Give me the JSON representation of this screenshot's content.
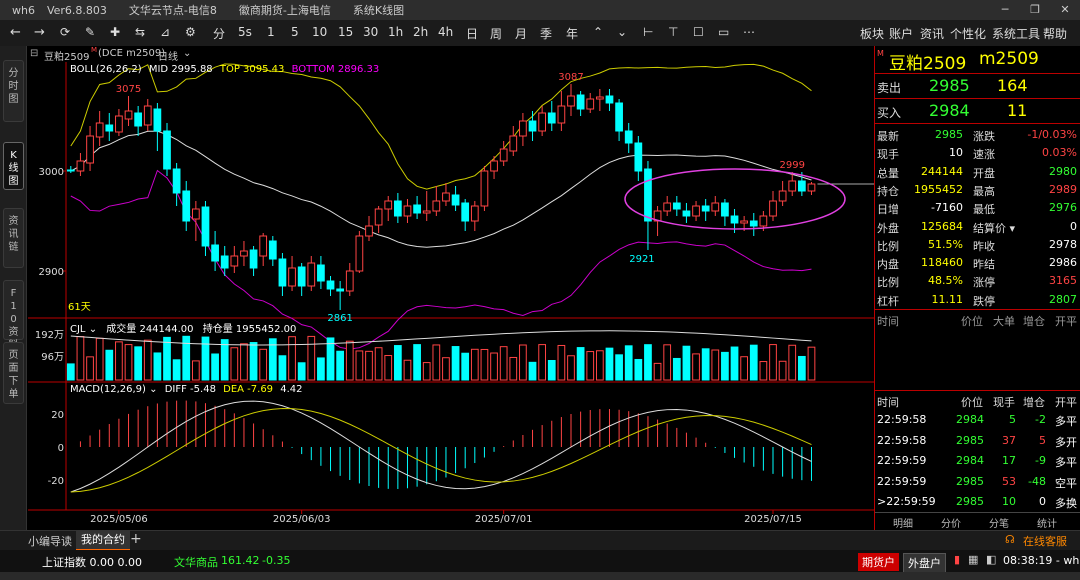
{
  "titlebar": {
    "app": "wh6",
    "version": "Ver6.8.803",
    "server": "文华云节点-电信8",
    "broker": "徽商期货-上海电信",
    "module": "系统K线图"
  },
  "toolbar": {
    "periods": [
      "分",
      "5s",
      "1",
      "5",
      "10",
      "15",
      "30",
      "1h",
      "2h",
      "4h",
      "日",
      "周",
      "月",
      "季",
      "年"
    ],
    "menu": [
      "板块",
      "账户",
      "资讯",
      "个性化",
      "系统工具",
      "帮助"
    ]
  },
  "sidebar": {
    "tabs": [
      "分时图",
      "K线图",
      "资讯链",
      "F10资料",
      "页面下单"
    ]
  },
  "chart_header": {
    "contract": "豆粕2509",
    "superscript": "M",
    "exchange": "(DCE m2509)",
    "period": "日线"
  },
  "boll": {
    "name": "BOLL(26,26,2)",
    "mid": "MID 2995.88",
    "top": "TOP 3095.43",
    "bottom": "BOTTOM 2896.33"
  },
  "cjl": {
    "name": "CJL",
    "vol": "成交量 244144.00",
    "oi": "持仓量 1955452.00",
    "ticks": [
      "192万",
      "96万"
    ]
  },
  "macd": {
    "name": "MACD(12,26,9)",
    "diff": "DIFF -5.48",
    "dea": "DEA -7.69",
    "macd": "4.42",
    "ticks": [
      "20",
      "0",
      "-20"
    ]
  },
  "price_labels": {
    "ticks": [
      "3000",
      "2900"
    ],
    "high1": "3075",
    "high2": "3087",
    "low1": "2861",
    "low2": "2921",
    "high3": "2999",
    "days": "61天"
  },
  "dates": [
    "2025/05/06",
    "2025/06/03",
    "2025/07/01",
    "2025/07/15"
  ],
  "chart_data": {
    "type": "candlestick",
    "title": "豆粕2509 日线",
    "ylim": [
      2855,
      3105
    ],
    "candles": [
      [
        3001,
        3000,
        2998,
        3005
      ],
      [
        3000,
        3010,
        2995,
        3018
      ],
      [
        3008,
        3035,
        3000,
        3045
      ],
      [
        3034,
        3048,
        3025,
        3060
      ],
      [
        3046,
        3040,
        3030,
        3058
      ],
      [
        3039,
        3055,
        3035,
        3062
      ],
      [
        3052,
        3060,
        3045,
        3075
      ],
      [
        3058,
        3045,
        3035,
        3065
      ],
      [
        3046,
        3065,
        3040,
        3072
      ],
      [
        3062,
        3040,
        3020,
        3068
      ],
      [
        3040,
        3002,
        2995,
        3048
      ],
      [
        3002,
        2978,
        2965,
        3008
      ],
      [
        2980,
        2950,
        2940,
        2990
      ],
      [
        2952,
        2962,
        2930,
        2970
      ],
      [
        2964,
        2925,
        2915,
        2970
      ],
      [
        2926,
        2910,
        2900,
        2940
      ],
      [
        2915,
        2903,
        2895,
        2925
      ],
      [
        2905,
        2915,
        2898,
        2925
      ],
      [
        2915,
        2920,
        2905,
        2930
      ],
      [
        2921,
        2903,
        2895,
        2925
      ],
      [
        2915,
        2935,
        2905,
        2938
      ],
      [
        2930,
        2912,
        2905,
        2935
      ],
      [
        2912,
        2885,
        2875,
        2918
      ],
      [
        2885,
        2903,
        2880,
        2915
      ],
      [
        2904,
        2885,
        2875,
        2908
      ],
      [
        2885,
        2908,
        2880,
        2915
      ],
      [
        2906,
        2890,
        2882,
        2915
      ],
      [
        2890,
        2882,
        2875,
        2895
      ],
      [
        2882,
        2880,
        2861,
        2890
      ],
      [
        2880,
        2900,
        2875,
        2908
      ],
      [
        2900,
        2935,
        2898,
        2940
      ],
      [
        2935,
        2945,
        2930,
        2955
      ],
      [
        2946,
        2962,
        2938,
        2965
      ],
      [
        2962,
        2970,
        2950,
        2975
      ],
      [
        2970,
        2955,
        2948,
        2978
      ],
      [
        2955,
        2965,
        2948,
        2972
      ],
      [
        2966,
        2958,
        2952,
        2975
      ],
      [
        2958,
        2960,
        2950,
        2980
      ],
      [
        2960,
        2970,
        2955,
        2985
      ],
      [
        2970,
        2978,
        2965,
        2988
      ],
      [
        2976,
        2966,
        2960,
        2985
      ],
      [
        2968,
        2950,
        2940,
        2972
      ],
      [
        2950,
        2965,
        2940,
        2970
      ],
      [
        2965,
        3000,
        2960,
        3005
      ],
      [
        3000,
        3010,
        2992,
        3015
      ],
      [
        3010,
        3022,
        3005,
        3030
      ],
      [
        3020,
        3035,
        3015,
        3045
      ],
      [
        3035,
        3050,
        3025,
        3058
      ],
      [
        3050,
        3040,
        3030,
        3060
      ],
      [
        3040,
        3058,
        3035,
        3065
      ],
      [
        3058,
        3048,
        3040,
        3070
      ],
      [
        3048,
        3065,
        3040,
        3080
      ],
      [
        3065,
        3075,
        3055,
        3087
      ],
      [
        3076,
        3062,
        3055,
        3080
      ],
      [
        3062,
        3072,
        3058,
        3078
      ],
      [
        3072,
        3074,
        3060,
        3082
      ],
      [
        3075,
        3068,
        3060,
        3082
      ],
      [
        3068,
        3040,
        3030,
        3072
      ],
      [
        3040,
        3028,
        3018,
        3048
      ],
      [
        3028,
        3000,
        2990,
        3035
      ],
      [
        3002,
        2950,
        2921,
        3010
      ],
      [
        2950,
        2960,
        2935,
        2965
      ],
      [
        2960,
        2968,
        2955,
        2975
      ],
      [
        2968,
        2962,
        2955,
        2975
      ],
      [
        2960,
        2955,
        2948,
        2968
      ],
      [
        2955,
        2965,
        2950,
        2970
      ],
      [
        2965,
        2960,
        2950,
        2972
      ],
      [
        2960,
        2968,
        2955,
        2975
      ],
      [
        2968,
        2955,
        2945,
        2972
      ],
      [
        2955,
        2948,
        2938,
        2962
      ],
      [
        2948,
        2950,
        2940,
        2955
      ],
      [
        2950,
        2945,
        2935,
        2958
      ],
      [
        2945,
        2955,
        2940,
        2960
      ],
      [
        2955,
        2970,
        2950,
        2980
      ],
      [
        2970,
        2980,
        2965,
        2990
      ],
      [
        2980,
        2990,
        2975,
        2999
      ],
      [
        2990,
        2980,
        2975,
        2999
      ],
      [
        2980,
        2987,
        2976,
        2989
      ]
    ]
  },
  "quote": {
    "title": "豆粕2509",
    "code": "m2509",
    "sell_label": "卖出",
    "sell": "2985",
    "sell_vol": "164",
    "buy_label": "买入",
    "buy": "2984",
    "buy_vol": "11",
    "rows": [
      [
        "最新",
        "2985",
        "g",
        "涨跌",
        "-1/0.03%",
        "r"
      ],
      [
        "现手",
        "10",
        "w",
        "速涨",
        "0.03%",
        "r"
      ],
      [
        "总量",
        "244144",
        "y",
        "开盘",
        "2980",
        "g"
      ],
      [
        "持仓",
        "1955452",
        "y",
        "最高",
        "2989",
        "r"
      ],
      [
        "日增",
        "-7160",
        "w",
        "最低",
        "2976",
        "g"
      ],
      [
        "外盘",
        "125684",
        "y",
        "结算价",
        "0",
        "w"
      ],
      [
        "比例",
        "51.5%",
        "y",
        "昨收",
        "2978",
        "w"
      ],
      [
        "内盘",
        "118460",
        "y",
        "昨结",
        "2986",
        "w"
      ],
      [
        "比例",
        "48.5%",
        "y",
        "涨停",
        "3165",
        "r"
      ],
      [
        "杠杆",
        "11.11",
        "y",
        "跌停",
        "2807",
        "g"
      ]
    ]
  },
  "ticks_header": [
    "时间",
    "价位",
    "大单",
    "增仓",
    "开平"
  ],
  "ticks_header2": [
    "时间",
    "价位",
    "现手",
    "增仓",
    "开平"
  ],
  "trades": [
    [
      "22:59:58",
      "2984",
      "5",
      "-2",
      "多平"
    ],
    [
      "22:59:58",
      "2985",
      "37",
      "5",
      "多开"
    ],
    [
      "22:59:59",
      "2984",
      "17",
      "-9",
      "多平"
    ],
    [
      "22:59:59",
      "2985",
      "53",
      "-48",
      "空平"
    ],
    [
      ">22:59:59",
      "2985",
      "10",
      "0",
      "多换"
    ]
  ],
  "rp_tabs": [
    "明细",
    "分价",
    "分笔",
    "统计"
  ],
  "bottom": {
    "tab1": "小编导读",
    "tab2": "我的合约",
    "add": "+",
    "service": "在线客服"
  },
  "status": {
    "index": "上证指数 0.00 0.00",
    "wh": "文华商品",
    "wh_val": "161.42",
    "wh_chg": "-0.35",
    "btn1": "期货户",
    "btn2": "外盘户",
    "time": "08:38:19 - wh"
  }
}
